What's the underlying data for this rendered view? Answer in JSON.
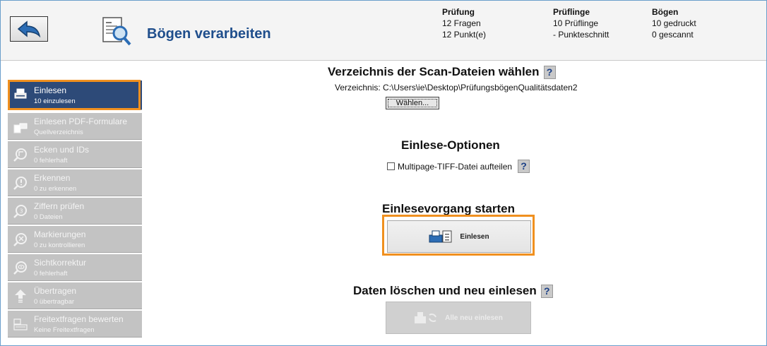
{
  "header": {
    "title": "Bögen verarbeiten",
    "stats": [
      {
        "heading": "Prüfung",
        "line1": "12 Fragen",
        "line2": "12 Punkt(e)"
      },
      {
        "heading": "Prüflinge",
        "line1": "10 Prüflinge",
        "line2": "- Punkteschnitt"
      },
      {
        "heading": "Bögen",
        "line1": "10 gedruckt",
        "line2": "0 gescannt"
      }
    ]
  },
  "sidebar": {
    "items": [
      {
        "label": "Einlesen",
        "sub": "10 einzulesen",
        "icon": "scanner-icon",
        "active": true
      },
      {
        "label": "Einlesen PDF-Formulare",
        "sub": "Quellverzeichnis",
        "icon": "pdf-scanner-icon"
      },
      {
        "label": "Ecken und IDs",
        "sub": "0 fehlerhaft",
        "icon": "corner-magnifier-icon"
      },
      {
        "label": "Erkennen",
        "sub": "0 zu erkennen",
        "icon": "exclamation-magnifier-icon"
      },
      {
        "label": "Ziffern prüfen",
        "sub": "0 Dateien",
        "icon": "number-magnifier-icon"
      },
      {
        "label": "Markierungen",
        "sub": "0 zu kontrollieren",
        "icon": "x-magnifier-icon"
      },
      {
        "label": "Sichtkorrektur",
        "sub": "0 fehlerhaft",
        "icon": "eye-magnifier-icon"
      },
      {
        "label": "Übertragen",
        "sub": "0 übertragbar",
        "icon": "upload-arrow-icon"
      },
      {
        "label": "Freitextfragen bewerten",
        "sub": "Keine Freitextfragen",
        "icon": "keyboard-icon"
      }
    ]
  },
  "main": {
    "dir_section": {
      "title": "Verzeichnis der Scan-Dateien wählen",
      "help": "?",
      "dir_line": "Verzeichnis: C:\\Users\\ie\\Desktop\\PrüfungsbögenQualitätsdaten2",
      "choose_label": "Wählen..."
    },
    "options_section": {
      "title": "Einlese-Optionen",
      "checkbox_label": "Multipage-TIFF-Datei aufteilen",
      "checkbox_checked": false,
      "help": "?"
    },
    "start_section": {
      "title": "Einlesevorgang starten",
      "button_label": "Einlesen"
    },
    "reset_section": {
      "title": "Daten löschen und neu einlesen",
      "help": "?",
      "button_label": "Alle neu einlesen"
    }
  },
  "colors": {
    "accent_outline": "#f0901f",
    "active_nav": "#2d4a78",
    "title_blue": "#1f4e8c",
    "nav_gray": "#c3c3c3"
  }
}
